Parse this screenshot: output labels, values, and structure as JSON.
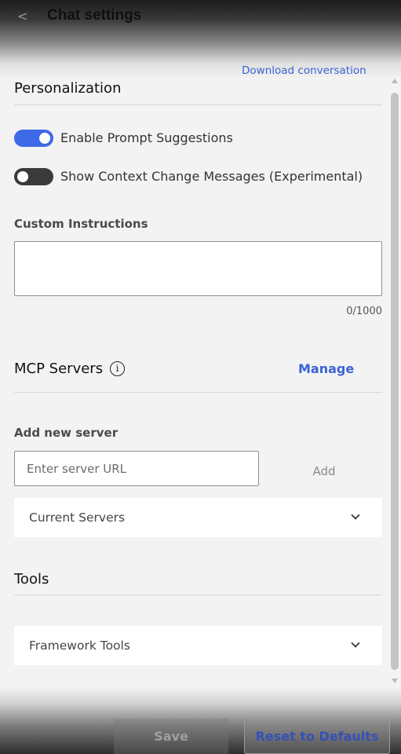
{
  "header": {
    "back_icon": "chevron-left-icon",
    "back_glyph": "<",
    "title": "Chat settings",
    "download_link": "Download conversation"
  },
  "personalization": {
    "title": "Personalization",
    "toggles": [
      {
        "label": "Enable Prompt Suggestions",
        "on": true
      },
      {
        "label": "Show Context Change Messages (Experimental)",
        "on": false
      }
    ],
    "custom_instructions": {
      "label": "Custom Instructions",
      "value": "",
      "counter": "0/1000"
    }
  },
  "mcp": {
    "title": "MCP Servers",
    "info_icon": "info-icon",
    "info_glyph": "i",
    "manage_label": "Manage",
    "add_label": "Add new server",
    "url_placeholder": "Enter server URL",
    "add_button": "Add",
    "current_servers": "Current Servers"
  },
  "tools": {
    "title": "Tools",
    "framework_tools": "Framework Tools"
  },
  "footer": {
    "save_label": "Save",
    "reset_label": "Reset to Defaults"
  },
  "colors": {
    "accent": "#3d6ae6",
    "link": "#3b63d3",
    "toggle_off": "#3a3a3a"
  }
}
